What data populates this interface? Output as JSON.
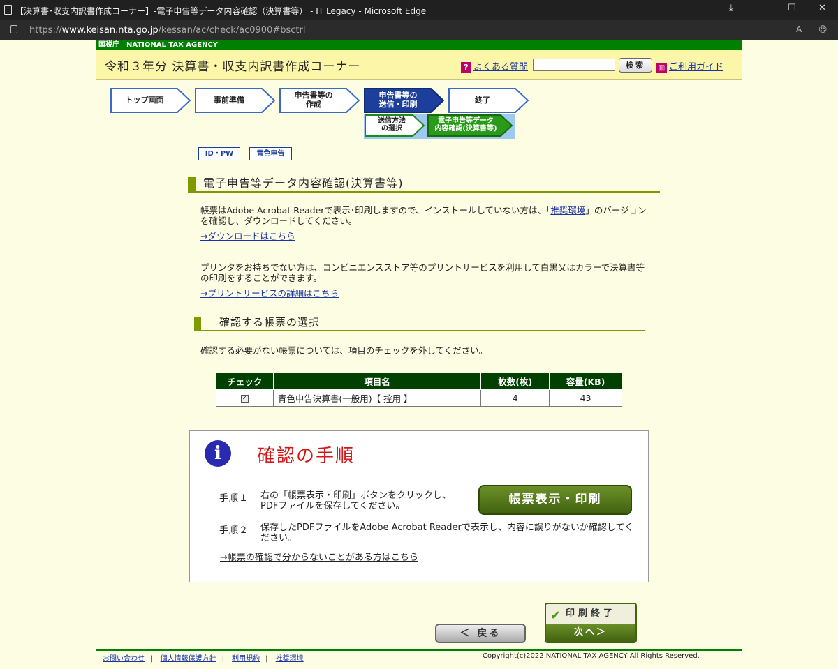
{
  "window": {
    "title": "【決算書･収支内訳書作成コーナー】-電子申告等データ内容確認（決算書等） - IT Legacy - Microsoft Edge",
    "url_prefix": "https://",
    "url_host": "www.keisan.nta.go.jp",
    "url_path": "/kessan/ac/check/ac0900#bsctrl",
    "controls": {
      "minimize": "—",
      "maximize": "☐",
      "close": "✕"
    }
  },
  "header": {
    "agency": "国税庁　NATIONAL TAX AGENCY",
    "title": "令和３年分 決算書・収支内訳書作成コーナー",
    "faq_icon": "?",
    "faq": "よくある質問",
    "search_placeholder": "",
    "search_button": "検索",
    "guide_icon": "📖",
    "guide": "ご利用ガイド"
  },
  "steps": [
    {
      "label": "トップ画面",
      "state": "done"
    },
    {
      "label": "事前準備",
      "state": "done"
    },
    {
      "label": "申告書等の\n作成",
      "state": "done"
    },
    {
      "label": "申告書等の\n送信・印刷",
      "state": "current"
    },
    {
      "label": "終了",
      "state": "todo"
    }
  ],
  "substeps": [
    {
      "label": "送信方法\nの選択",
      "state": "done"
    },
    {
      "label": "電子申告等データ\n内容確認(決算書等)",
      "state": "current"
    }
  ],
  "tabs": {
    "idpw": "ID・PW",
    "blue": "青色申告"
  },
  "main": {
    "heading": "電子申告等データ内容確認(決算書等)",
    "para1_a": "帳票はAdobe Acrobat Readerで表示･印刷しますので、インストールしていない方は、「",
    "para1_link": "推奨環境",
    "para1_b": "」のバージョンを確認し、ダウンロードしてください。",
    "download_link": "→ダウンロードはこちら",
    "para2": "プリンタをお持ちでない方は、コンビニエンスストア等のプリントサービスを利用して白黒又はカラーで決算書等の印刷をすることができます。",
    "print_link": "→プリントサービスの詳細はこちら",
    "subheading": "確認する帳票の選択",
    "select_note": "確認する必要がない帳票については、項目のチェックを外してください。"
  },
  "table": {
    "headers": [
      "チェック",
      "項目名",
      "枚数(枚)",
      "容量(KB)"
    ],
    "rows": [
      {
        "checked": "✓",
        "name": "青色申告決算書(一般用)【 控用 】",
        "pages": "4",
        "size": "43"
      }
    ]
  },
  "panel": {
    "icon": "i",
    "title": "確認の手順",
    "step1_label": "手順１",
    "step1_text": "右の「帳票表示・印刷」ボタンをクリックし、PDFファイルを保存してください。",
    "print_button": "帳票表示・印刷",
    "step2_label": "手順２",
    "step2_text": "保存したPDFファイルをAdobe Acrobat Readerで表示し、内容に誤りがないか確認してください。",
    "help_link": "→帳票の確認で分からないことがある方はこちら"
  },
  "buttons": {
    "back": "＜ 戻る",
    "done_check": "✔",
    "done_top": "印刷終了",
    "done_bottom": "次へ＞"
  },
  "footer": {
    "links": [
      "お問い合わせ",
      "個人情報保護方針",
      "利用規約",
      "推奨環境"
    ],
    "copyright": "Copyright(c)2022 NATIONAL TAX AGENCY All Rights Reserved."
  }
}
